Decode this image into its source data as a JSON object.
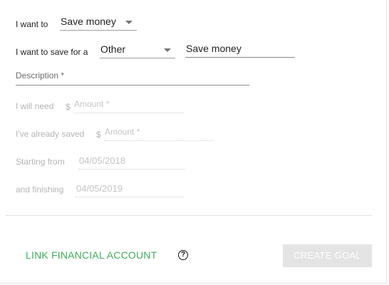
{
  "form": {
    "i_want_to_label": "I want to",
    "goal_type_value": "Save money",
    "save_for_label": "I want to save for a",
    "category_value": "Other",
    "goal_name_value": "Save money",
    "description_placeholder": "Description *",
    "need_label": "I will need",
    "need_currency": "$",
    "need_placeholder": "Amount *",
    "saved_label": "I've already saved",
    "saved_currency": "$",
    "saved_placeholder": "Amount *",
    "start_label": "Starting from",
    "start_date": "04/05/2018",
    "end_label": "and finishing",
    "end_date": "04/05/2019"
  },
  "footer": {
    "link_label": "LINK FINANCIAL ACCOUNT",
    "help_glyph": "?",
    "create_label": "CREATE GOAL"
  }
}
